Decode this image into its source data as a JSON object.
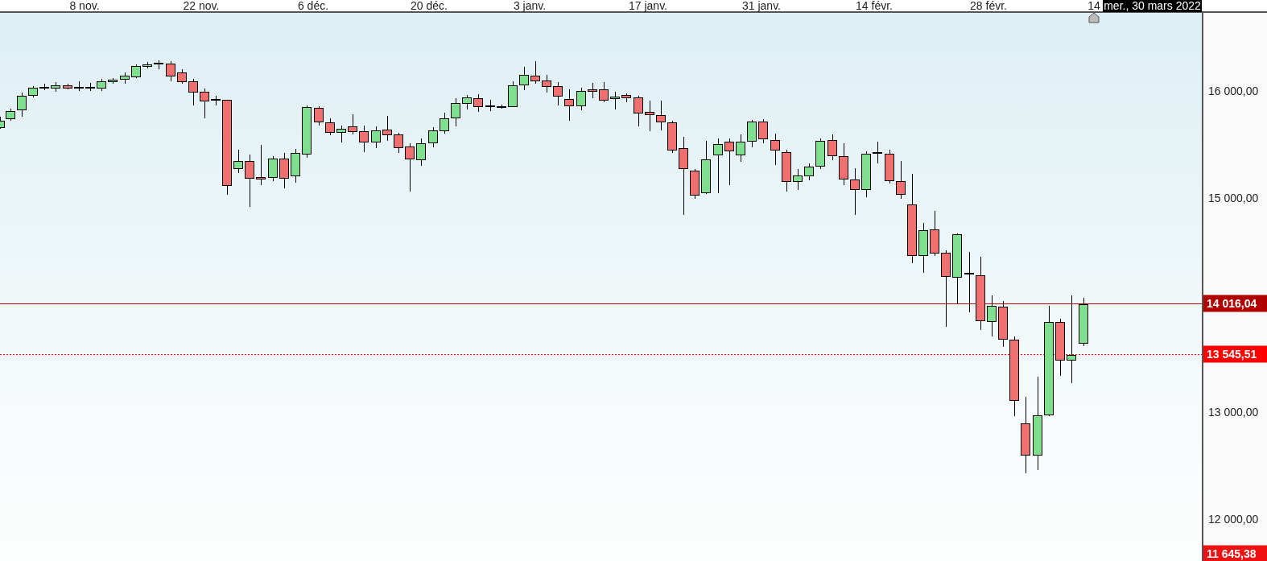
{
  "x_axis": {
    "labels": [
      "8 nov.",
      "22 nov.",
      "6 déc.",
      "20 déc.",
      "3 janv.",
      "17 janv.",
      "31 janv.",
      "14 févr.",
      "28 févr.",
      "14"
    ]
  },
  "cursor": {
    "date": "mer., 30 mars 2022"
  },
  "y_axis": {
    "labels": [
      "16 000,00",
      "15 000,00",
      "13 000,00",
      "12 000,00"
    ]
  },
  "price_tags": [
    {
      "value": "14 016,04",
      "kind": "solid",
      "color": "#b00000"
    },
    {
      "value": "13 545,51",
      "kind": "dotted",
      "color": "#ff0000"
    },
    {
      "value": "11 645,38",
      "kind": "none",
      "color": "#ee1111"
    }
  ]
}
